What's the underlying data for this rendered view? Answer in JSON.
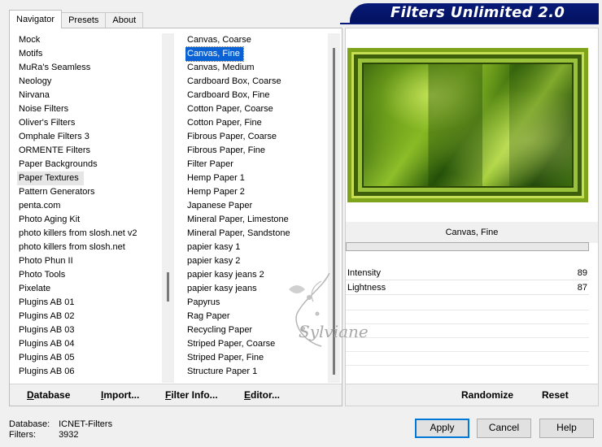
{
  "tabs": [
    {
      "label": "Navigator",
      "active": true
    },
    {
      "label": "Presets",
      "active": false
    },
    {
      "label": "About",
      "active": false
    }
  ],
  "banner": {
    "title": "Filters Unlimited 2.0",
    "color": "#071a78"
  },
  "categories": [
    "Mock",
    "Motifs",
    "MuRa's Seamless",
    "Neology",
    "Nirvana",
    "Noise Filters",
    "Oliver's Filters",
    "Omphale Filters 3",
    "ORMENTE Filters",
    "Paper Backgrounds",
    "Paper Textures",
    "Pattern Generators",
    "penta.com",
    "Photo Aging Kit",
    "photo killers from slosh.net v2",
    "photo killers from slosh.net",
    "Photo Phun II",
    "Photo Tools",
    "Pixelate",
    "Plugins AB 01",
    "Plugins AB 02",
    "Plugins AB 03",
    "Plugins AB 04",
    "Plugins AB 05",
    "Plugins AB 06"
  ],
  "selected_category": "Paper Textures",
  "filters": [
    "Canvas, Coarse",
    "Canvas, Fine",
    "Canvas, Medium",
    "Cardboard Box, Coarse",
    "Cardboard Box, Fine",
    "Cotton Paper, Coarse",
    "Cotton Paper, Fine",
    "Fibrous Paper, Coarse",
    "Fibrous Paper, Fine",
    "Filter Paper",
    "Hemp Paper 1",
    "Hemp Paper 2",
    "Japanese Paper",
    "Mineral Paper, Limestone",
    "Mineral Paper, Sandstone",
    "papier kasy 1",
    "papier kasy 2",
    "papier kasy jeans 2",
    "papier kasy jeans",
    "Papyrus",
    "Rag Paper",
    "Recycling Paper",
    "Striped Paper, Coarse",
    "Striped Paper, Fine",
    "Structure Paper 1"
  ],
  "selected_filter": "Canvas, Fine",
  "left_buttons": {
    "database": "Database",
    "import": "Import...",
    "filter_info": "Filter Info...",
    "editor": "Editor..."
  },
  "preview": {
    "filter_name": "Canvas, Fine"
  },
  "sliders": [
    {
      "label": "Intensity",
      "value": "89"
    },
    {
      "label": "Lightness",
      "value": "87"
    }
  ],
  "right_buttons": {
    "randomize": "Randomize",
    "reset": "Reset"
  },
  "status": {
    "database_label": "Database:",
    "database_value": "ICNET-Filters",
    "filters_label": "Filters:",
    "filters_value": "3932"
  },
  "dialog_buttons": {
    "apply": "Apply",
    "cancel": "Cancel",
    "help": "Help"
  },
  "watermark": {
    "text": "Sylviane"
  }
}
